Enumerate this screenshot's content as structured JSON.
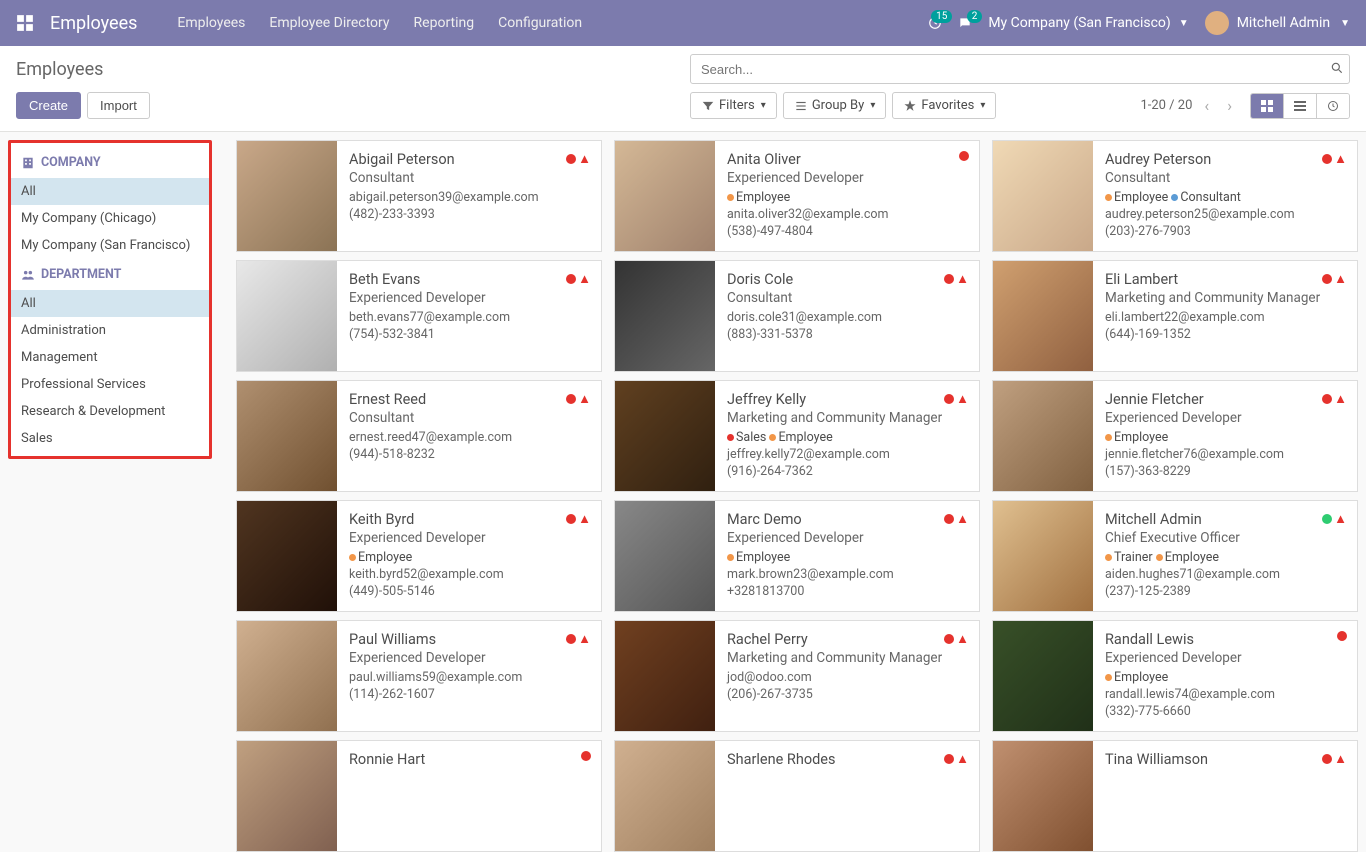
{
  "topnav": {
    "brand": "Employees",
    "menu": [
      "Employees",
      "Employee Directory",
      "Reporting",
      "Configuration"
    ],
    "activity_count": "15",
    "message_count": "2",
    "company": "My Company (San Francisco)",
    "user": "Mitchell Admin"
  },
  "control": {
    "title": "Employees",
    "create": "Create",
    "import": "Import",
    "search_placeholder": "Search...",
    "filters": "Filters",
    "groupby": "Group By",
    "favorites": "Favorites",
    "pager": "1-20 / 20"
  },
  "sidebar": {
    "company_header": "COMPANY",
    "companies": [
      "All",
      "My Company (Chicago)",
      "My Company (San Francisco)"
    ],
    "dept_header": "DEPARTMENT",
    "departments": [
      "All",
      "Administration",
      "Management",
      "Professional Services",
      "Research & Development",
      "Sales"
    ]
  },
  "employees": [
    {
      "name": "Abigail Peterson",
      "title": "Consultant",
      "tags": [],
      "email": "abigail.peterson39@example.com",
      "phone": "(482)-233-3393",
      "status": "red",
      "warn": true,
      "img": "p1"
    },
    {
      "name": "Anita Oliver",
      "title": "Experienced Developer",
      "tags": [
        {
          "c": "orange",
          "t": "Employee"
        }
      ],
      "email": "anita.oliver32@example.com",
      "phone": "(538)-497-4804",
      "status": "red",
      "warn": false,
      "img": "p2"
    },
    {
      "name": "Audrey Peterson",
      "title": "Consultant",
      "tags": [
        {
          "c": "orange",
          "t": "Employee"
        },
        {
          "c": "blue",
          "t": "Consultant"
        }
      ],
      "email": "audrey.peterson25@example.com",
      "phone": "(203)-276-7903",
      "status": "red",
      "warn": true,
      "img": "p3"
    },
    {
      "name": "Beth Evans",
      "title": "Experienced Developer",
      "tags": [],
      "email": "beth.evans77@example.com",
      "phone": "(754)-532-3841",
      "status": "red",
      "warn": true,
      "img": "p4"
    },
    {
      "name": "Doris Cole",
      "title": "Consultant",
      "tags": [],
      "email": "doris.cole31@example.com",
      "phone": "(883)-331-5378",
      "status": "red",
      "warn": true,
      "img": "p5"
    },
    {
      "name": "Eli Lambert",
      "title": "Marketing and Community Manager",
      "tags": [],
      "email": "eli.lambert22@example.com",
      "phone": "(644)-169-1352",
      "status": "red",
      "warn": true,
      "img": "p6"
    },
    {
      "name": "Ernest Reed",
      "title": "Consultant",
      "tags": [],
      "email": "ernest.reed47@example.com",
      "phone": "(944)-518-8232",
      "status": "red",
      "warn": true,
      "img": "p7"
    },
    {
      "name": "Jeffrey Kelly",
      "title": "Marketing and Community Manager",
      "tags": [
        {
          "c": "red",
          "t": "Sales"
        },
        {
          "c": "orange",
          "t": "Employee"
        }
      ],
      "email": "jeffrey.kelly72@example.com",
      "phone": "(916)-264-7362",
      "status": "red",
      "warn": true,
      "img": "p8"
    },
    {
      "name": "Jennie Fletcher",
      "title": "Experienced Developer",
      "tags": [
        {
          "c": "orange",
          "t": "Employee"
        }
      ],
      "email": "jennie.fletcher76@example.com",
      "phone": "(157)-363-8229",
      "status": "red",
      "warn": true,
      "img": "p9"
    },
    {
      "name": "Keith Byrd",
      "title": "Experienced Developer",
      "tags": [
        {
          "c": "orange",
          "t": "Employee"
        }
      ],
      "email": "keith.byrd52@example.com",
      "phone": "(449)-505-5146",
      "status": "red",
      "warn": true,
      "img": "p10"
    },
    {
      "name": "Marc Demo",
      "title": "Experienced Developer",
      "tags": [
        {
          "c": "orange",
          "t": "Employee"
        }
      ],
      "email": "mark.brown23@example.com",
      "phone": "+3281813700",
      "status": "red",
      "warn": true,
      "img": "p11"
    },
    {
      "name": "Mitchell Admin",
      "title": "Chief Executive Officer",
      "tags": [
        {
          "c": "orange",
          "t": "Trainer"
        },
        {
          "c": "orange",
          "t": "Employee"
        }
      ],
      "email": "aiden.hughes71@example.com",
      "phone": "(237)-125-2389",
      "status": "green",
      "warn": true,
      "img": "p12"
    },
    {
      "name": "Paul Williams",
      "title": "Experienced Developer",
      "tags": [],
      "email": "paul.williams59@example.com",
      "phone": "(114)-262-1607",
      "status": "red",
      "warn": true,
      "img": "p13"
    },
    {
      "name": "Rachel Perry",
      "title": "Marketing and Community Manager",
      "tags": [],
      "email": "jod@odoo.com",
      "phone": "(206)-267-3735",
      "status": "red",
      "warn": true,
      "img": "p14"
    },
    {
      "name": "Randall Lewis",
      "title": "Experienced Developer",
      "tags": [
        {
          "c": "orange",
          "t": "Employee"
        }
      ],
      "email": "randall.lewis74@example.com",
      "phone": "(332)-775-6660",
      "status": "red",
      "warn": false,
      "img": "p15"
    },
    {
      "name": "Ronnie Hart",
      "title": "",
      "tags": [],
      "email": "",
      "phone": "",
      "status": "red",
      "warn": false,
      "img": "p16"
    },
    {
      "name": "Sharlene Rhodes",
      "title": "",
      "tags": [],
      "email": "",
      "phone": "",
      "status": "red",
      "warn": true,
      "img": "p17"
    },
    {
      "name": "Tina Williamson",
      "title": "",
      "tags": [],
      "email": "",
      "phone": "",
      "status": "red",
      "warn": true,
      "img": "p18"
    }
  ]
}
